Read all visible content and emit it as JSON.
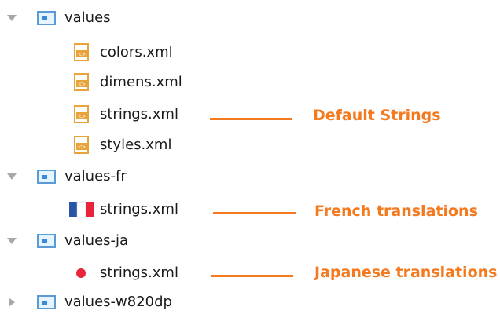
{
  "tree": {
    "folders": [
      {
        "name": "values",
        "expanded": true,
        "files": [
          {
            "name": "colors.xml",
            "icon": "xml-file-icon"
          },
          {
            "name": "dimens.xml",
            "icon": "xml-file-icon"
          },
          {
            "name": "strings.xml",
            "icon": "xml-file-icon"
          },
          {
            "name": "styles.xml",
            "icon": "xml-file-icon"
          }
        ]
      },
      {
        "name": "values-fr",
        "expanded": true,
        "files": [
          {
            "name": "strings.xml",
            "icon": "french-flag-icon"
          }
        ]
      },
      {
        "name": "values-ja",
        "expanded": true,
        "files": [
          {
            "name": "strings.xml",
            "icon": "japanese-flag-icon"
          }
        ]
      },
      {
        "name": "values-w820dp",
        "expanded": false,
        "files": []
      }
    ]
  },
  "annotations": {
    "default": "Default Strings",
    "french": "French translations",
    "japanese": "Japanese translations"
  },
  "colors": {
    "accent": "#f47a20",
    "folder_fill": "#e6f4ff",
    "folder_stroke": "#5b9bd5",
    "xml_icon": "#e8a33a"
  }
}
